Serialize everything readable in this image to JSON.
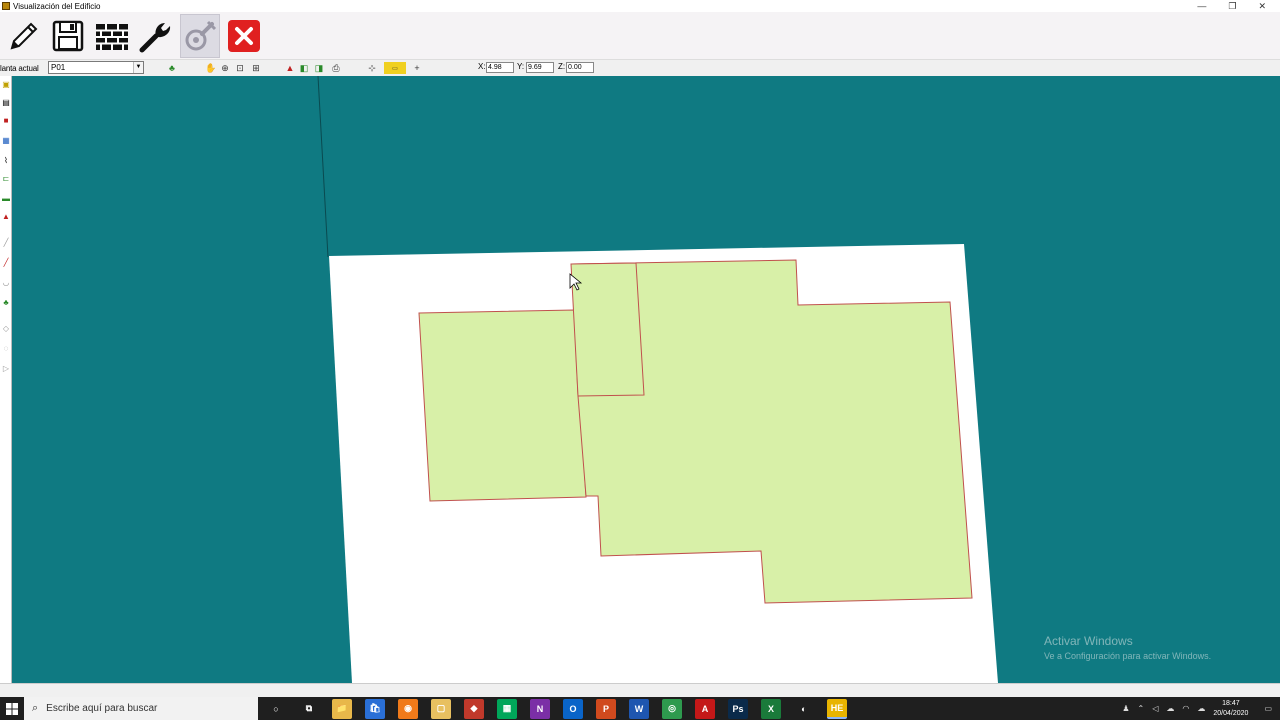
{
  "window": {
    "title": "Visualización del Edificio",
    "controls": [
      "—",
      "❐",
      "✕"
    ]
  },
  "toolbar": {
    "buttons": [
      {
        "name": "edit-button",
        "icon": "pencil-icon"
      },
      {
        "name": "save-button",
        "icon": "floppy-icon"
      },
      {
        "name": "walls-button",
        "icon": "brick-wall-icon"
      },
      {
        "name": "tools-button",
        "icon": "wrench-icon"
      },
      {
        "name": "settings-button",
        "icon": "gear-wrench-icon",
        "disabled": true
      },
      {
        "name": "close-button",
        "icon": "close-icon"
      }
    ]
  },
  "subbar": {
    "planta_label": "lanta actual",
    "planta_value": "P01",
    "x_label": "X:",
    "x_value": "4.98",
    "y_label": "Y:",
    "y_value": "9.69",
    "z_label": "Z:",
    "z_value": "0.00"
  },
  "canvas": {
    "background": "#0f7a82",
    "plate_color": "#ffffff",
    "zone_fill": "#d8f0a8",
    "zone_stroke": "#c0504d"
  },
  "watermark": {
    "line1": "Activar Windows",
    "line2": "Ve a Configuración para activar Windows."
  },
  "taskbar": {
    "search_placeholder": "Escribe aquí para buscar",
    "apps": [
      {
        "label": "○",
        "color": "transparent"
      },
      {
        "label": "⧉",
        "color": "transparent"
      },
      {
        "label": "📁",
        "color": "#e8b84a"
      },
      {
        "label": "🛍",
        "color": "#2a6fd6"
      },
      {
        "label": "◉",
        "color": "#f07a1a"
      },
      {
        "label": "▢",
        "color": "#e8c060"
      },
      {
        "label": "◆",
        "color": "#c0392b"
      },
      {
        "label": "▦",
        "color": "#00a65a"
      },
      {
        "label": "N",
        "color": "#7b2fa6"
      },
      {
        "label": "O",
        "color": "#0a64c8"
      },
      {
        "label": "P",
        "color": "#d04a1e"
      },
      {
        "label": "W",
        "color": "#1e56b0"
      },
      {
        "label": "◎",
        "color": "#2e9a4e"
      },
      {
        "label": "A",
        "color": "#c41818"
      },
      {
        "label": "Ps",
        "color": "#0a2a4a"
      },
      {
        "label": "X",
        "color": "#1a7a3a"
      },
      {
        "label": "◐",
        "color": "transparent"
      },
      {
        "label": "HE",
        "color": "#e8b400"
      }
    ],
    "time": "18:47",
    "date": "20/04/2020"
  }
}
